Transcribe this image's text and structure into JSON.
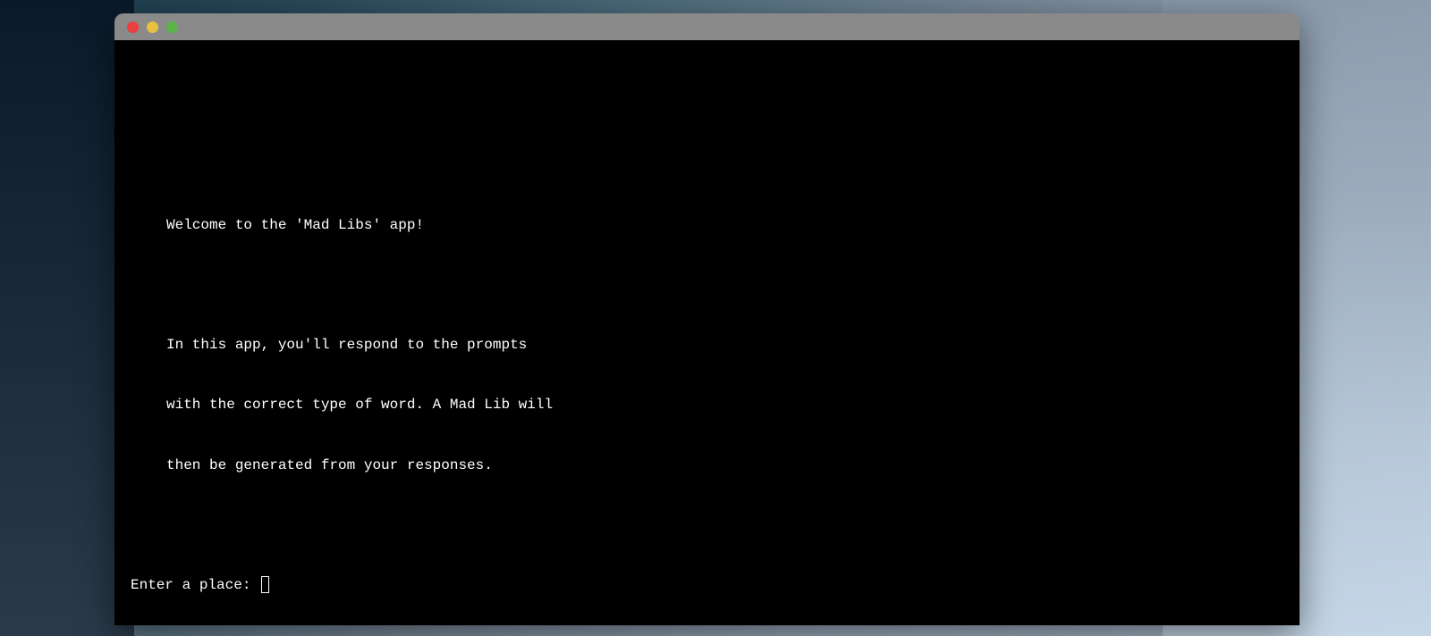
{
  "terminal": {
    "output": {
      "line1": "Welcome to the 'Mad Libs' app!",
      "line2": "In this app, you'll respond to the prompts",
      "line3": "with the correct type of word. A Mad Lib will",
      "line4": "then be generated from your responses."
    },
    "prompt": "Enter a place: "
  }
}
